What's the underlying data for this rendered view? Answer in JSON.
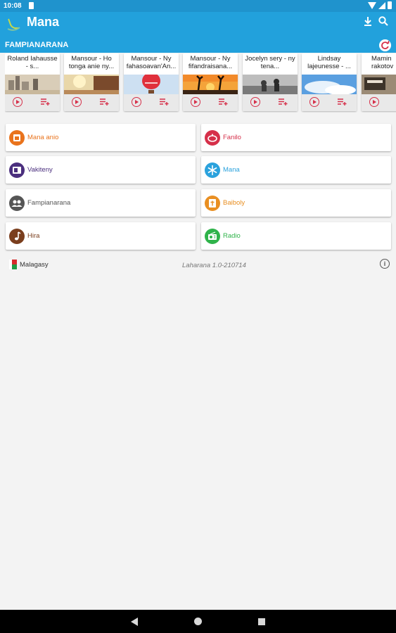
{
  "status_bar": {
    "time": "10:08"
  },
  "app_bar": {
    "title": "Mana",
    "actions": [
      "download-icon",
      "search-icon"
    ]
  },
  "section": {
    "title": "FAMPIANARANA"
  },
  "carousel": {
    "items": [
      {
        "title": "Roland Iahausse - s...",
        "image": "desert-buildings"
      },
      {
        "title": "Mansour - Ho tonga anie ny...",
        "image": "sunset-wall"
      },
      {
        "title": "Mansour - Ny fahasoavan'An...",
        "image": "hot-air-balloon"
      },
      {
        "title": "Mansour - Ny fifandraisana...",
        "image": "silhouette-sunset"
      },
      {
        "title": "Jocelyn sery - ny tena...",
        "image": "people-on-rocks"
      },
      {
        "title": "Lindsay lajeunesse - ...",
        "image": "blue-sky-clouds"
      },
      {
        "title": "Mamin rakotov",
        "image": "city-street"
      }
    ]
  },
  "menu": [
    {
      "label": "Mana anio",
      "color": "#e9731c",
      "icon": "calendar-icon"
    },
    {
      "label": "Fanilo",
      "color": "#d6304a",
      "icon": "lamp-icon"
    },
    {
      "label": "Vakiteny",
      "color": "#4b2f7e",
      "icon": "book-icon"
    },
    {
      "label": "Mana",
      "color": "#2ba2dd",
      "icon": "snowflake-icon"
    },
    {
      "label": "Fampianarana",
      "color": "#555555",
      "icon": "people-icon"
    },
    {
      "label": "Baiboly",
      "color": "#e98f22",
      "icon": "bible-icon"
    },
    {
      "label": "Hira",
      "color": "#7a3e1d",
      "icon": "music-note-icon"
    },
    {
      "label": "Radio",
      "color": "#2fb34a",
      "icon": "radio-icon"
    }
  ],
  "footer": {
    "language": "Malagasy",
    "version": "Laharana 1.0-210714"
  }
}
